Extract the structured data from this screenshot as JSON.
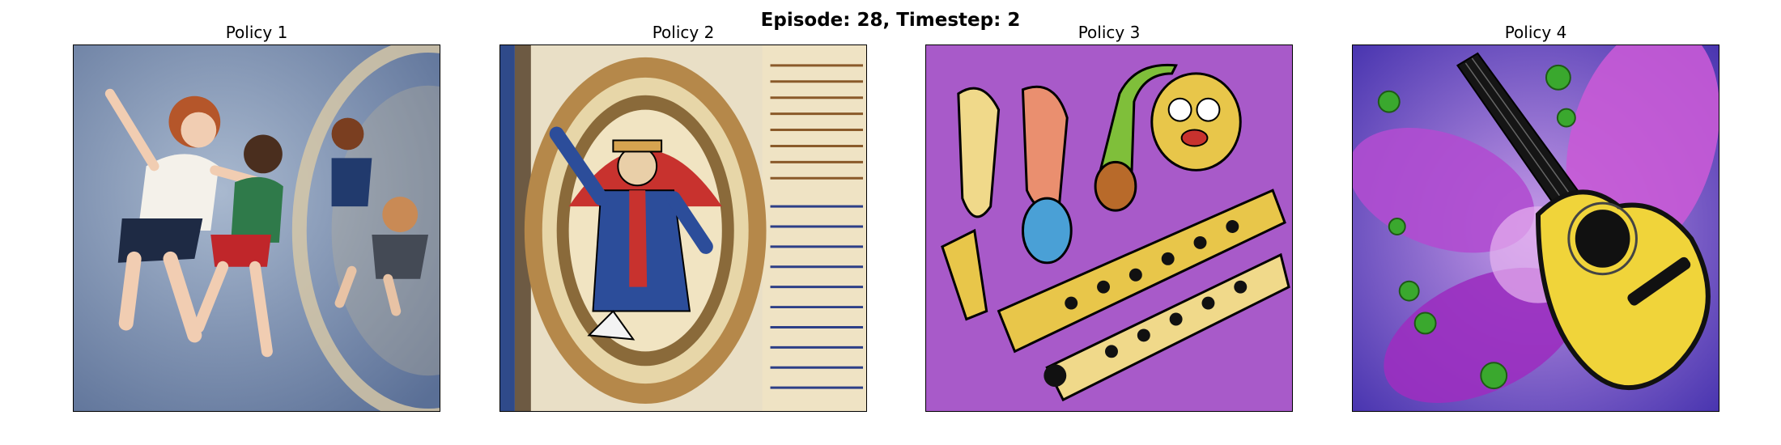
{
  "figure": {
    "title": "Episode: 28, Timestep: 2"
  },
  "panels": [
    {
      "title": "Policy 1"
    },
    {
      "title": "Policy 2"
    },
    {
      "title": "Policy 3"
    },
    {
      "title": "Policy 4"
    }
  ]
}
